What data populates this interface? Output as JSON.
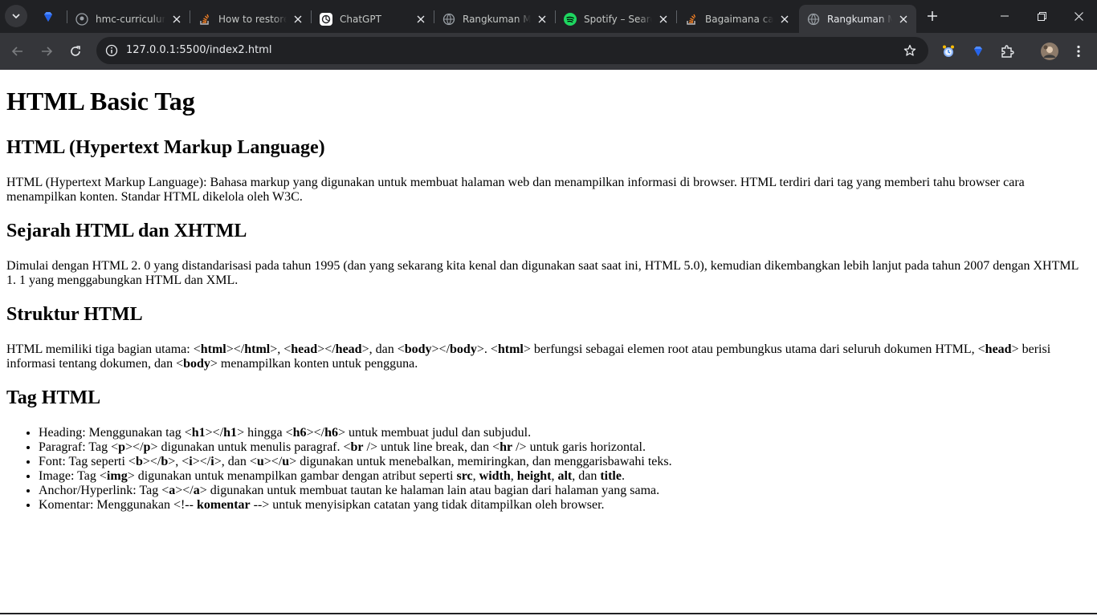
{
  "browser": {
    "pinned_tab_icon": "diamond-icon",
    "tabs": [
      {
        "title": "hmc-curriculum",
        "icon": "github-icon",
        "active": false
      },
      {
        "title": "How to restore",
        "icon": "stackoverflow-icon",
        "active": false
      },
      {
        "title": "ChatGPT",
        "icon": "chatgpt-icon",
        "active": false
      },
      {
        "title": "Rangkuman Ma",
        "icon": "globe-icon",
        "active": false
      },
      {
        "title": "Spotify – Search",
        "icon": "spotify-icon",
        "active": false
      },
      {
        "title": "Bagaimana cara",
        "icon": "stackoverflow-icon",
        "active": false
      },
      {
        "title": "Rangkuman Ma",
        "icon": "globe-icon",
        "active": true
      }
    ],
    "url": "127.0.0.1:5500/index2.html",
    "colors": {
      "chrome_dark": "#202124",
      "chrome_toolbar": "#35363a",
      "spotify": "#1ed760",
      "stackoverflow": "#f48024"
    }
  },
  "page": {
    "title": "HTML Basic Tag",
    "sections": {
      "html": {
        "heading": "HTML (Hypertext Markup Language)",
        "text": "HTML (Hypertext Markup Language): Bahasa markup yang digunakan untuk membuat halaman web dan menampilkan informasi di browser. HTML terdiri dari tag yang memberi tahu browser cara menampilkan konten. Standar HTML dikelola oleh W3C."
      },
      "sejarah": {
        "heading": "Sejarah HTML dan XHTML",
        "text": "Dimulai dengan HTML 2. 0 yang distandarisasi pada tahun 1995 (dan yang sekarang kita kenal dan digunakan saat saat ini, HTML 5.0), kemudian dikembangkan lebih lanjut pada tahun 2007 dengan XHTML 1. 1 yang menggabungkan HTML dan XML."
      },
      "struktur": {
        "heading": "Struktur HTML",
        "t1": "HTML memiliki tiga bagian utama: <",
        "b1": "html",
        "t2": "></",
        "b2": "html",
        "t3": ">, <",
        "b3": "head",
        "t4": "></",
        "b4": "head",
        "t5": ">, dan <",
        "b5": "body",
        "t6": "></",
        "b6": "body",
        "t7": ">. <",
        "b7": "html",
        "t8": "> berfungsi sebagai elemen root atau pembungkus utama dari seluruh dokumen HTML, <",
        "b8": "head",
        "t9": "> berisi informasi tentang dokumen, dan <",
        "b9": "body",
        "t10": "> menampilkan konten untuk pengguna."
      },
      "tag": {
        "heading": "Tag HTML",
        "items": {
          "heading": {
            "t1": "Heading: Menggunakan tag <",
            "b1": "h1",
            "t2": "></",
            "b2": "h1",
            "t3": "> hingga <",
            "b3": "h6",
            "t4": "></",
            "b4": "h6",
            "t5": "> untuk membuat judul dan subjudul."
          },
          "paragraf": {
            "t1": "Paragraf: Tag <",
            "b1": "p",
            "t2": "></",
            "b2": "p",
            "t3": "> digunakan untuk menulis paragraf. <",
            "b3": "br",
            "t4": " /> untuk line break, dan <",
            "b4": "hr",
            "t5": " /> untuk garis horizontal."
          },
          "font": {
            "t1": "Font: Tag seperti <",
            "b1": "b",
            "t2": "></",
            "b2": "b",
            "t3": ">, <",
            "b3": "i",
            "t4": "></",
            "b4": "i",
            "t5": ">, dan <",
            "b5": "u",
            "t6": "></",
            "b6": "u",
            "t7": "> digunakan untuk menebalkan, memiringkan, dan menggarisbawahi teks."
          },
          "image": {
            "t1": "Image: Tag <",
            "b1": "img",
            "t2": "> digunakan untuk menampilkan gambar dengan atribut seperti ",
            "b2": "src",
            "t3": ", ",
            "b3": "width",
            "t4": ", ",
            "b4": "height",
            "t5": ", ",
            "b5": "alt",
            "t6": ", dan ",
            "b6": "title",
            "t7": "."
          },
          "anchor": {
            "t1": "Anchor/Hyperlink: Tag <",
            "b1": "a",
            "t2": "></",
            "b2": "a",
            "t3": "> digunakan untuk membuat tautan ke halaman lain atau bagian dari halaman yang sama."
          },
          "komentar": {
            "t1": "Komentar: Menggunakan <!-- ",
            "b1": "komentar",
            "t2": " --> untuk menyisipkan catatan yang tidak ditampilkan oleh browser."
          }
        }
      }
    }
  }
}
